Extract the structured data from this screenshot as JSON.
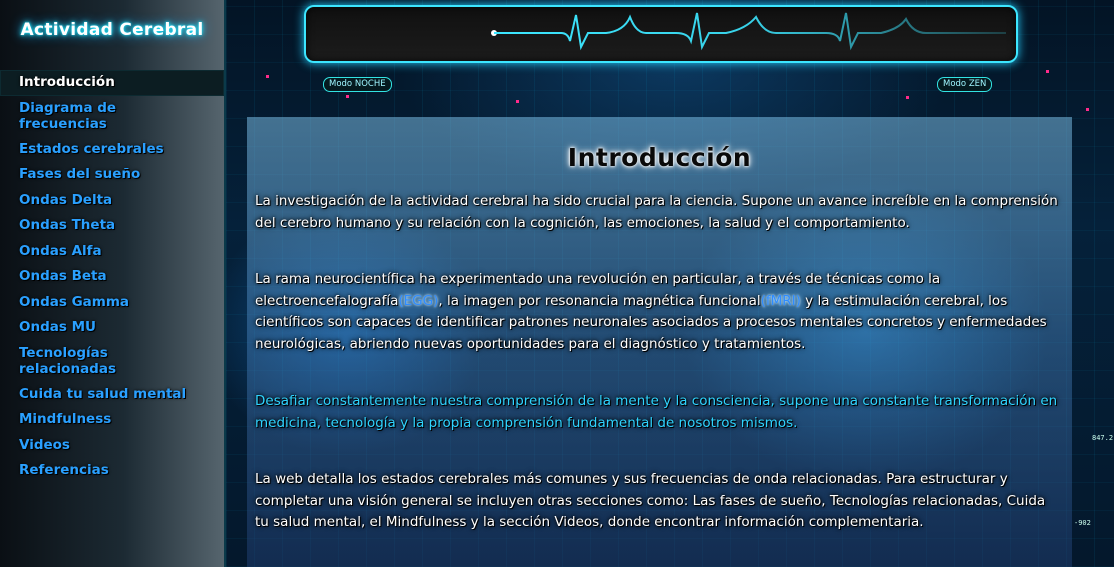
{
  "sidebar": {
    "title": "Actividad Cerebral",
    "items": [
      {
        "label": "Introducción"
      },
      {
        "label": "Diagrama de frecuencias"
      },
      {
        "label": "Estados cerebrales"
      },
      {
        "label": "Fases del sueño"
      },
      {
        "label": "Ondas Delta"
      },
      {
        "label": "Ondas Theta"
      },
      {
        "label": "Ondas Alfa"
      },
      {
        "label": "Ondas Beta"
      },
      {
        "label": "Ondas Gamma"
      },
      {
        "label": "Ondas MU"
      },
      {
        "label": "Tecnologías relacionadas"
      },
      {
        "label": "Cuida tu salud mental"
      },
      {
        "label": "Mindfulness"
      },
      {
        "label": "Videos"
      },
      {
        "label": "Referencias"
      }
    ]
  },
  "header": {
    "night_mode": "Modo NOCHE",
    "zen_mode": "Modo ZEN"
  },
  "main": {
    "title": "Introducción",
    "p1": "La investigación de la actividad cerebral ha sido crucial para la ciencia. Supone un avance increíble en la comprensión del cerebro humano y su relación con la cognición, las emociones, la salud y el comportamiento.",
    "p2_a": "La rama neurocientífica ha experimentado una revolución en particular, a través de técnicas como la electroencefalografía",
    "p2_egg": "(EGG)",
    "p2_b": ", la imagen por resonancia magnética funcional",
    "p2_fmri": "(fMRI)",
    "p2_c": " y la estimulación cerebral, los científicos son capaces de identificar patrones neuronales asociados a procesos mentales concretos y enfermedades neurológicas, abriendo nuevas oportunidades para el diagnóstico y tratamientos.",
    "p3": "Desafiar constantemente nuestra comprensión de la mente y la consciencia, supone una constante transformación en medicina, tecnología y la propia comprensión fundamental de nosotros mismos.",
    "p4": "La web detalla los estados cerebrales más comunes y sus frecuencias de onda relacionadas. Para estructurar y completar una visión general se incluyen otras secciones como: Las fases de sueño, Tecnologías relacionadas, Cuida tu salud mental, el Mindfulness y la sección Videos, donde encontrar información complementaria."
  },
  "decor": {
    "readout_1": "847.2",
    "readout_2": "-902"
  },
  "colors": {
    "accent": "#2aa0ff",
    "neon": "#3ce6ff",
    "highlight": "#2e8cff"
  }
}
